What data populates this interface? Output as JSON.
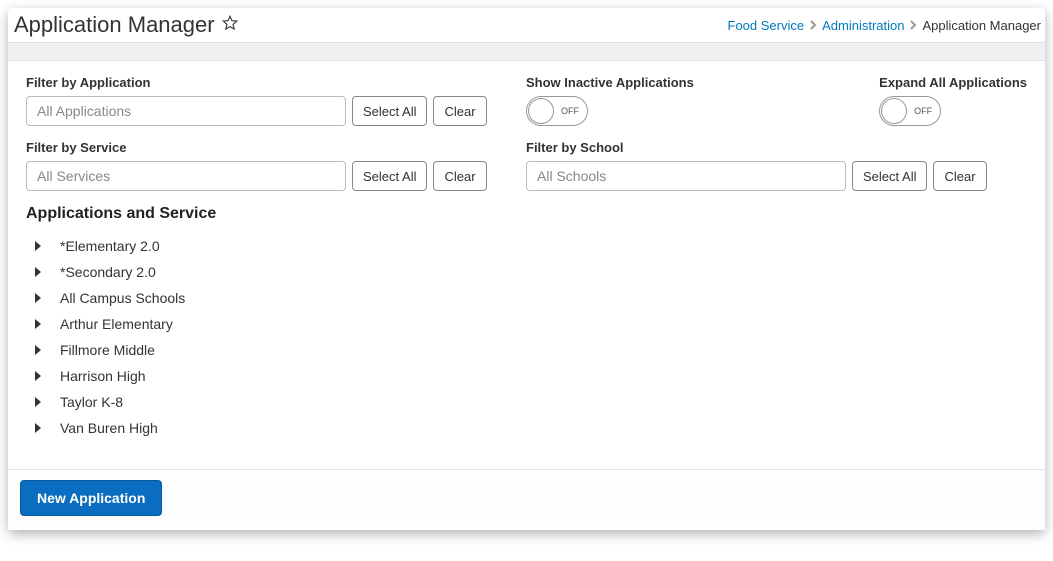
{
  "header": {
    "title": "Application Manager"
  },
  "breadcrumb": {
    "items": [
      {
        "label": "Food Service",
        "link": true
      },
      {
        "label": "Administration",
        "link": true
      },
      {
        "label": "Application Manager",
        "link": false
      }
    ]
  },
  "filters": {
    "application": {
      "label": "Filter by Application",
      "placeholder": "All Applications",
      "select_all": "Select All",
      "clear": "Clear"
    },
    "service": {
      "label": "Filter by Service",
      "placeholder": "All Services",
      "select_all": "Select All",
      "clear": "Clear"
    },
    "school": {
      "label": "Filter by School",
      "placeholder": "All Schools",
      "select_all": "Select All",
      "clear": "Clear"
    },
    "inactive": {
      "label": "Show Inactive Applications",
      "state": "OFF"
    },
    "expand": {
      "label": "Expand All Applications",
      "state": "OFF"
    }
  },
  "section": {
    "title": "Applications and Service",
    "items": [
      "*Elementary 2.0",
      "*Secondary 2.0",
      "All Campus Schools",
      "Arthur Elementary",
      "Fillmore Middle",
      "Harrison High",
      "Taylor K-8",
      "Van Buren High"
    ]
  },
  "footer": {
    "new_application": "New Application"
  }
}
